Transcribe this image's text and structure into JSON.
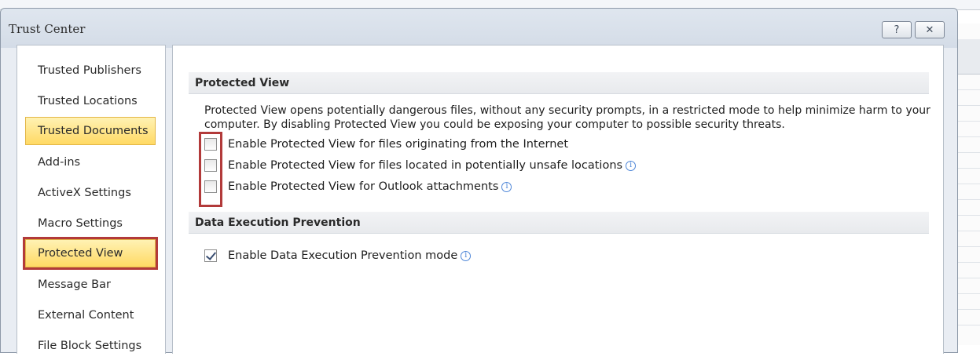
{
  "dialog": {
    "title": "Trust Center",
    "help_label": "?",
    "close_label": "✕"
  },
  "nav": {
    "items": [
      {
        "label": "Trusted Publishers",
        "active": false
      },
      {
        "label": "Trusted Locations",
        "active": false
      },
      {
        "label": "Trusted Documents",
        "active": true
      },
      {
        "label": "Add-ins",
        "active": false
      },
      {
        "label": "ActiveX Settings",
        "active": false
      },
      {
        "label": "Macro Settings",
        "active": false
      },
      {
        "label": "Protected View",
        "active": true,
        "highlighted": true
      },
      {
        "label": "Message Bar",
        "active": false
      },
      {
        "label": "External Content",
        "active": false
      },
      {
        "label": "File Block Settings",
        "active": false
      }
    ]
  },
  "protected_view": {
    "header": "Protected View",
    "description": "Protected View opens potentially dangerous files, without any security prompts, in a restricted mode to help minimize harm to your computer. By disabling Protected View you could be exposing your computer to possible security threats.",
    "options": [
      {
        "label": "Enable Protected View for files originating from the Internet",
        "checked": false,
        "info_icon": false
      },
      {
        "label": "Enable Protected View for files located in potentially unsafe locations",
        "checked": false,
        "info_icon": true
      },
      {
        "label": "Enable Protected View for Outlook attachments",
        "checked": false,
        "info_icon": true
      }
    ]
  },
  "dep": {
    "header": "Data Execution Prevention",
    "options": [
      {
        "label": "Enable Data Execution Prevention mode",
        "checked": true,
        "info_icon": true
      }
    ]
  },
  "icons": {
    "info": "info-icon",
    "checkbox": "checkbox"
  },
  "colors": {
    "accent_active": "#ffd964",
    "highlight_outline": "#b23a3a",
    "info_blue": "#4f87d8"
  }
}
